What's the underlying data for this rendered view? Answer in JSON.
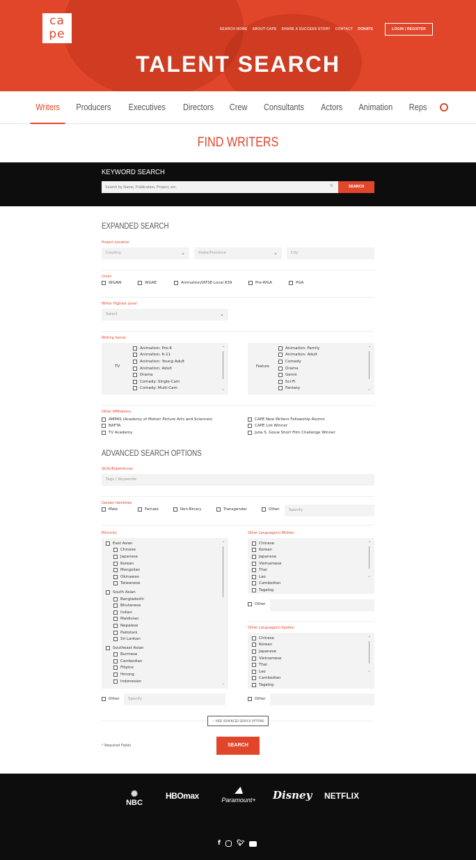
{
  "header": {
    "logo_text": "cape",
    "nav": [
      "SEARCH HOME",
      "ABOUT CAPE",
      "SHARE A SUCCESS STORY",
      "CONTACT"
    ],
    "donate": "DONATE",
    "login": "LOGIN | REGISTER",
    "title": "TALENT SEARCH"
  },
  "categories": [
    "Writers",
    "Producers",
    "Executives",
    "Directors",
    "Crew",
    "Consultants",
    "Actors",
    "Animation",
    "Reps"
  ],
  "page_title": "FIND WRITERS",
  "keyword": {
    "label": "KEYWORD SEARCH",
    "placeholder": "Search by Name, Publication, Project, etc.",
    "button": "SEARCH"
  },
  "expanded": {
    "title": "EXPANDED SEARCH",
    "location": {
      "label": "Project Location",
      "country": "Country",
      "state": "State/Province",
      "city": "City"
    },
    "union": {
      "label": "Union",
      "options": [
        "WGAW",
        "WGAE",
        "Animation/IATSE Local 839",
        "Pre-WGA",
        "PGA"
      ]
    },
    "level": {
      "label": "Writer Highest Level",
      "value": "Select"
    },
    "genre": {
      "label": "Writing Genre",
      "tv_label": "TV",
      "tv": [
        "Animation: Pre-K",
        "Animation: 6-11",
        "Animation: Young Adult",
        "Animation: Adult",
        "Drama",
        "Comedy: Single-Cam",
        "Comedy: Multi-Cam"
      ],
      "feature_label": "Feature",
      "feature": [
        "Animation: Family",
        "Animation: Adult",
        "Comedy",
        "Drama",
        "Genre",
        "Sci-Fi",
        "Fantasy"
      ]
    },
    "affiliations": {
      "label": "Other Affiliations",
      "left": [
        "AMPAS (Academy of Motion Picture Arts and Sciences)",
        "BAFTA",
        "TV Academy"
      ],
      "right": [
        "CAPE New Writers Fellowship Alumni",
        "CAPE List Winner",
        "Julia S. Gouw Short Film Challenge Winner"
      ]
    }
  },
  "advanced": {
    "title": "ADVANCED SEARCH OPTIONS",
    "skills": {
      "label": "Skills/Experiences",
      "placeholder": "Tags / Keywords"
    },
    "gender": {
      "label": "Gender Identities",
      "options": [
        "Male",
        "Female",
        "Non-Binary",
        "Transgender",
        "Other"
      ],
      "specify": "Specify"
    },
    "ethnicity": {
      "label": "Ethnicity",
      "groups": [
        {
          "name": "East Asian",
          "items": [
            "Chinese",
            "Japanese",
            "Korean",
            "Mongolian",
            "Okinawan",
            "Taiwanese"
          ]
        },
        {
          "name": "South Asian",
          "items": [
            "Bangladeshi",
            "Bhutanese",
            "Indian",
            "Maldivian",
            "Nepalese",
            "Pakistani",
            "Sri Lankan"
          ]
        },
        {
          "name": "Southeast Asian",
          "items": [
            "Burmese",
            "Cambodian",
            "Filipinx",
            "Hmong",
            "Indonesian"
          ]
        }
      ],
      "other": "Other",
      "specify": "Specify"
    },
    "written": {
      "label": "Other Language(s) Written",
      "items": [
        "Chinese",
        "Korean",
        "Japanese",
        "Vietnamese",
        "Thai",
        "Lao",
        "Cambodian",
        "Tagalog"
      ],
      "other": "Other"
    },
    "spoken": {
      "label": "Other Language(s) Spoken",
      "items": [
        "Chinese",
        "Korean",
        "Japanese",
        "Vietnamese",
        "Thai",
        "Lao",
        "Cambodian",
        "Tagalog"
      ],
      "other": "Other"
    }
  },
  "hide_button": "HIDE ADVANCED SEARCH OPTIONS",
  "required": {
    "mark": "*",
    "text": "Required Fields"
  },
  "search_button": "SEARCH",
  "footer": {
    "brands": [
      "NBC",
      "HBOmax",
      "Paramount+",
      "Disney",
      "NETFLIX"
    ],
    "social": [
      "facebook-icon",
      "instagram-icon",
      "twitter-icon",
      "youtube-icon"
    ]
  },
  "colors": {
    "accent": "#e2462a",
    "dark": "#0d0d0d",
    "field": "#f3f3f3"
  }
}
